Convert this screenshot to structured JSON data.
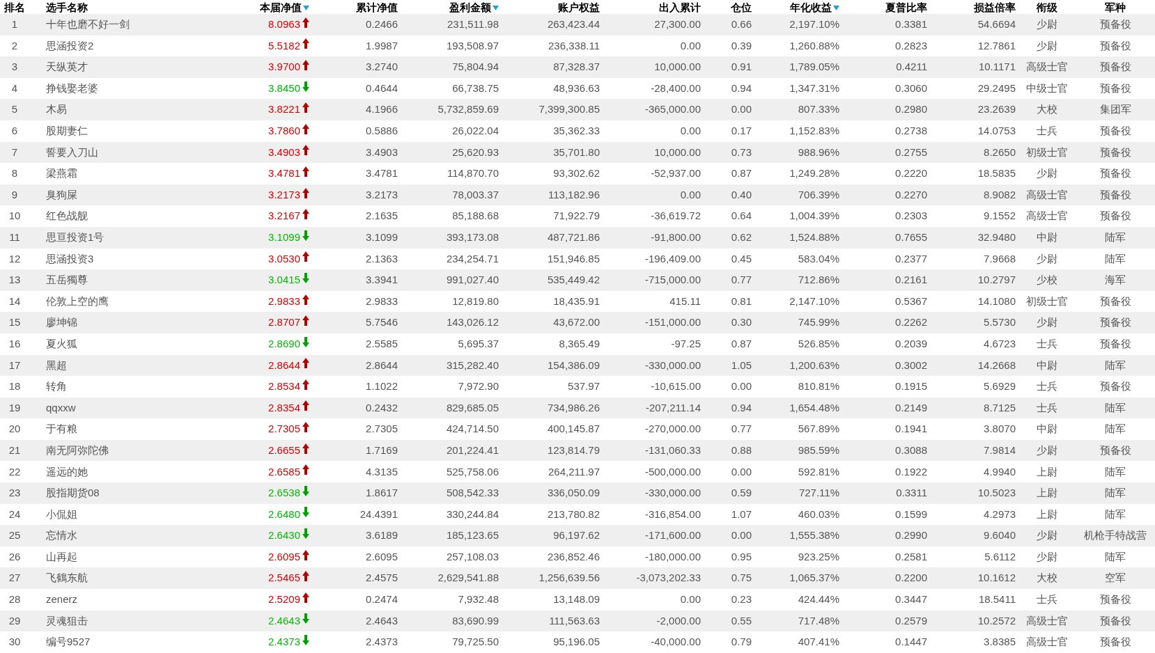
{
  "table": {
    "columns": [
      {
        "label": "排名",
        "sort_indicator": false
      },
      {
        "label": "选手名称",
        "sort_indicator": false
      },
      {
        "label": "本届净值",
        "sort_indicator": true
      },
      {
        "label": "累计净值",
        "sort_indicator": false
      },
      {
        "label": "盈利金额",
        "sort_indicator": true
      },
      {
        "label": "账户权益",
        "sort_indicator": false
      },
      {
        "label": "出入累计",
        "sort_indicator": false
      },
      {
        "label": "仓位",
        "sort_indicator": false
      },
      {
        "label": "年化收益",
        "sort_indicator": true
      },
      {
        "label": "夏普比率",
        "sort_indicator": false
      },
      {
        "label": "损益倍率",
        "sort_indicator": false
      },
      {
        "label": "衔级",
        "sort_indicator": false
      },
      {
        "label": "军种",
        "sort_indicator": false
      }
    ],
    "rows": [
      {
        "cells": [
          "1",
          "十年也磨不好一剑",
          "8.0963",
          "0.2466",
          "231,511.98",
          "263,423.44",
          "27,300.00",
          "0.66",
          "2,197.10%",
          "0.3381",
          "54.6694",
          "少尉",
          "预备役"
        ],
        "rising": true
      },
      {
        "cells": [
          "2",
          "思涵投资2",
          "5.5182",
          "1.9987",
          "193,508.97",
          "236,338.11",
          "0.00",
          "0.39",
          "1,260.88%",
          "0.2823",
          "12.7861",
          "少尉",
          "预备役"
        ],
        "rising": true
      },
      {
        "cells": [
          "3",
          "天纵英才",
          "3.9700",
          "3.2740",
          "75,804.94",
          "87,328.37",
          "10,000.00",
          "0.91",
          "1,789.05%",
          "0.4211",
          "10.1171",
          "高级士官",
          "预备役"
        ],
        "rising": true
      },
      {
        "cells": [
          "4",
          "挣钱娶老婆",
          "3.8450",
          "0.4644",
          "66,738.75",
          "48,936.63",
          "-28,400.00",
          "0.94",
          "1,347.31%",
          "0.3060",
          "29.2495",
          "中级士官",
          "预备役"
        ],
        "rising": false
      },
      {
        "cells": [
          "5",
          "木易",
          "3.8221",
          "4.1966",
          "5,732,859.69",
          "7,399,300.85",
          "-365,000.00",
          "0.00",
          "807.33%",
          "0.2980",
          "23.2639",
          "大校",
          "集团军"
        ],
        "rising": true
      },
      {
        "cells": [
          "6",
          "股期妻仁",
          "3.7860",
          "0.5886",
          "26,022.04",
          "35,362.33",
          "0.00",
          "0.17",
          "1,152.83%",
          "0.2738",
          "14.0753",
          "士兵",
          "预备役"
        ],
        "rising": true
      },
      {
        "cells": [
          "7",
          "誓要入刀山",
          "3.4903",
          "3.4903",
          "25,620.93",
          "35,701.80",
          "10,000.00",
          "0.73",
          "988.96%",
          "0.2755",
          "8.2650",
          "初级士官",
          "预备役"
        ],
        "rising": true
      },
      {
        "cells": [
          "8",
          "梁燕霜",
          "3.4781",
          "3.4781",
          "114,870.70",
          "93,302.62",
          "-52,937.00",
          "0.87",
          "1,249.28%",
          "0.2220",
          "18.5835",
          "少尉",
          "预备役"
        ],
        "rising": true
      },
      {
        "cells": [
          "9",
          "臭狗屎",
          "3.2173",
          "3.2173",
          "78,003.37",
          "113,182.96",
          "0.00",
          "0.40",
          "706.39%",
          "0.2270",
          "8.9082",
          "高级士官",
          "预备役"
        ],
        "rising": true
      },
      {
        "cells": [
          "10",
          "红色战舰",
          "3.2167",
          "2.1635",
          "85,188.68",
          "71,922.79",
          "-36,619.72",
          "0.64",
          "1,004.39%",
          "0.2303",
          "9.1552",
          "高级士官",
          "预备役"
        ],
        "rising": true
      },
      {
        "cells": [
          "11",
          "思亘投资1号",
          "3.1099",
          "3.1099",
          "393,173.08",
          "487,721.86",
          "-91,800.00",
          "0.62",
          "1,524.88%",
          "0.7655",
          "32.9480",
          "中尉",
          "陆军"
        ],
        "rising": false
      },
      {
        "cells": [
          "12",
          "思涵投资3",
          "3.0530",
          "2.1363",
          "234,254.71",
          "151,946.85",
          "-196,409.00",
          "0.45",
          "583.04%",
          "0.2377",
          "7.9668",
          "少尉",
          "陆军"
        ],
        "rising": true
      },
      {
        "cells": [
          "13",
          "五岳獨尊",
          "3.0415",
          "3.3941",
          "991,027.40",
          "535,449.42",
          "-715,000.00",
          "0.77",
          "712.86%",
          "0.2161",
          "10.2797",
          "少校",
          "海军"
        ],
        "rising": false
      },
      {
        "cells": [
          "14",
          "伦敦上空的鹰",
          "2.9833",
          "2.9833",
          "12,819.80",
          "18,435.91",
          "415.11",
          "0.81",
          "2,147.10%",
          "0.5367",
          "14.1080",
          "初级士官",
          "预备役"
        ],
        "rising": true
      },
      {
        "cells": [
          "15",
          "廖坤锦",
          "2.8707",
          "5.7546",
          "143,026.12",
          "43,672.00",
          "-151,000.00",
          "0.30",
          "745.99%",
          "0.2262",
          "5.5730",
          "少尉",
          "预备役"
        ],
        "rising": true
      },
      {
        "cells": [
          "16",
          "夏火狐",
          "2.8690",
          "2.5585",
          "5,695.37",
          "8,365.49",
          "-97.25",
          "0.87",
          "526.85%",
          "0.2039",
          "4.6723",
          "士兵",
          "预备役"
        ],
        "rising": false
      },
      {
        "cells": [
          "17",
          "黑超",
          "2.8644",
          "2.8644",
          "315,282.40",
          "154,386.09",
          "-330,000.00",
          "1.05",
          "1,200.63%",
          "0.3002",
          "14.2668",
          "中尉",
          "陆军"
        ],
        "rising": true
      },
      {
        "cells": [
          "18",
          "转角",
          "2.8534",
          "1.1022",
          "7,972.90",
          "537.97",
          "-10,615.00",
          "0.00",
          "810.81%",
          "0.1915",
          "5.6929",
          "士兵",
          "预备役"
        ],
        "rising": true
      },
      {
        "cells": [
          "19",
          "qqxxw",
          "2.8354",
          "0.2432",
          "829,685.05",
          "734,986.26",
          "-207,211.14",
          "0.94",
          "1,654.48%",
          "0.2149",
          "8.7125",
          "士兵",
          "陆军"
        ],
        "rising": true
      },
      {
        "cells": [
          "20",
          "于有粮",
          "2.7305",
          "2.7305",
          "424,714.50",
          "400,145.87",
          "-270,000.00",
          "0.77",
          "567.89%",
          "0.1941",
          "3.8070",
          "中尉",
          "陆军"
        ],
        "rising": true
      },
      {
        "cells": [
          "21",
          "南无阿弥陀佛",
          "2.6655",
          "1.7169",
          "201,224.41",
          "123,814.79",
          "-131,060.33",
          "0.88",
          "985.59%",
          "0.3088",
          "7.9814",
          "少尉",
          "预备役"
        ],
        "rising": true
      },
      {
        "cells": [
          "22",
          "遥远的她",
          "2.6585",
          "4.3135",
          "525,758.06",
          "264,211.97",
          "-500,000.00",
          "0.00",
          "592.81%",
          "0.1922",
          "4.9940",
          "上尉",
          "陆军"
        ],
        "rising": true
      },
      {
        "cells": [
          "23",
          "股指期货08",
          "2.6538",
          "1.8617",
          "508,542.33",
          "336,050.09",
          "-330,000.00",
          "0.59",
          "727.11%",
          "0.3311",
          "10.5023",
          "上尉",
          "陆军"
        ],
        "rising": false
      },
      {
        "cells": [
          "24",
          "小侃姐",
          "2.6480",
          "24.4391",
          "330,244.84",
          "213,780.82",
          "-316,854.00",
          "1.07",
          "460.03%",
          "0.1599",
          "4.2973",
          "上尉",
          "陆军"
        ],
        "rising": false
      },
      {
        "cells": [
          "25",
          "忘情水",
          "2.6430",
          "3.6189",
          "185,123.65",
          "96,197.62",
          "-171,600.00",
          "0.00",
          "1,555.38%",
          "0.2990",
          "9.6040",
          "少尉",
          "机枪手特战营"
        ],
        "rising": false
      },
      {
        "cells": [
          "26",
          "山再起",
          "2.6095",
          "2.6095",
          "257,108.03",
          "236,852.46",
          "-180,000.00",
          "0.95",
          "923.25%",
          "0.2581",
          "5.6112",
          "少尉",
          "陆军"
        ],
        "rising": true
      },
      {
        "cells": [
          "27",
          "飞鶴东航",
          "2.5465",
          "2.4575",
          "2,629,541.88",
          "1,256,639.56",
          "-3,073,202.33",
          "0.75",
          "1,065.37%",
          "0.2200",
          "10.1612",
          "大校",
          "空军"
        ],
        "rising": true
      },
      {
        "cells": [
          "28",
          "zenerz",
          "2.5209",
          "0.2474",
          "7,932.48",
          "13,148.09",
          "0.00",
          "0.23",
          "424.44%",
          "0.3447",
          "18.5411",
          "士兵",
          "预备役"
        ],
        "rising": true
      },
      {
        "cells": [
          "29",
          "灵魂狙击",
          "2.4643",
          "2.4643",
          "83,690.99",
          "111,563.63",
          "-2,000.00",
          "0.55",
          "717.48%",
          "0.2579",
          "10.2572",
          "高级士官",
          "预备役"
        ],
        "rising": false
      },
      {
        "cells": [
          "30",
          "编号9527",
          "2.4373",
          "2.4373",
          "79,725.50",
          "95,196.05",
          "-40,000.00",
          "0.79",
          "407.41%",
          "0.1447",
          "3.8385",
          "高级士官",
          "预备役"
        ],
        "rising": false
      }
    ]
  }
}
